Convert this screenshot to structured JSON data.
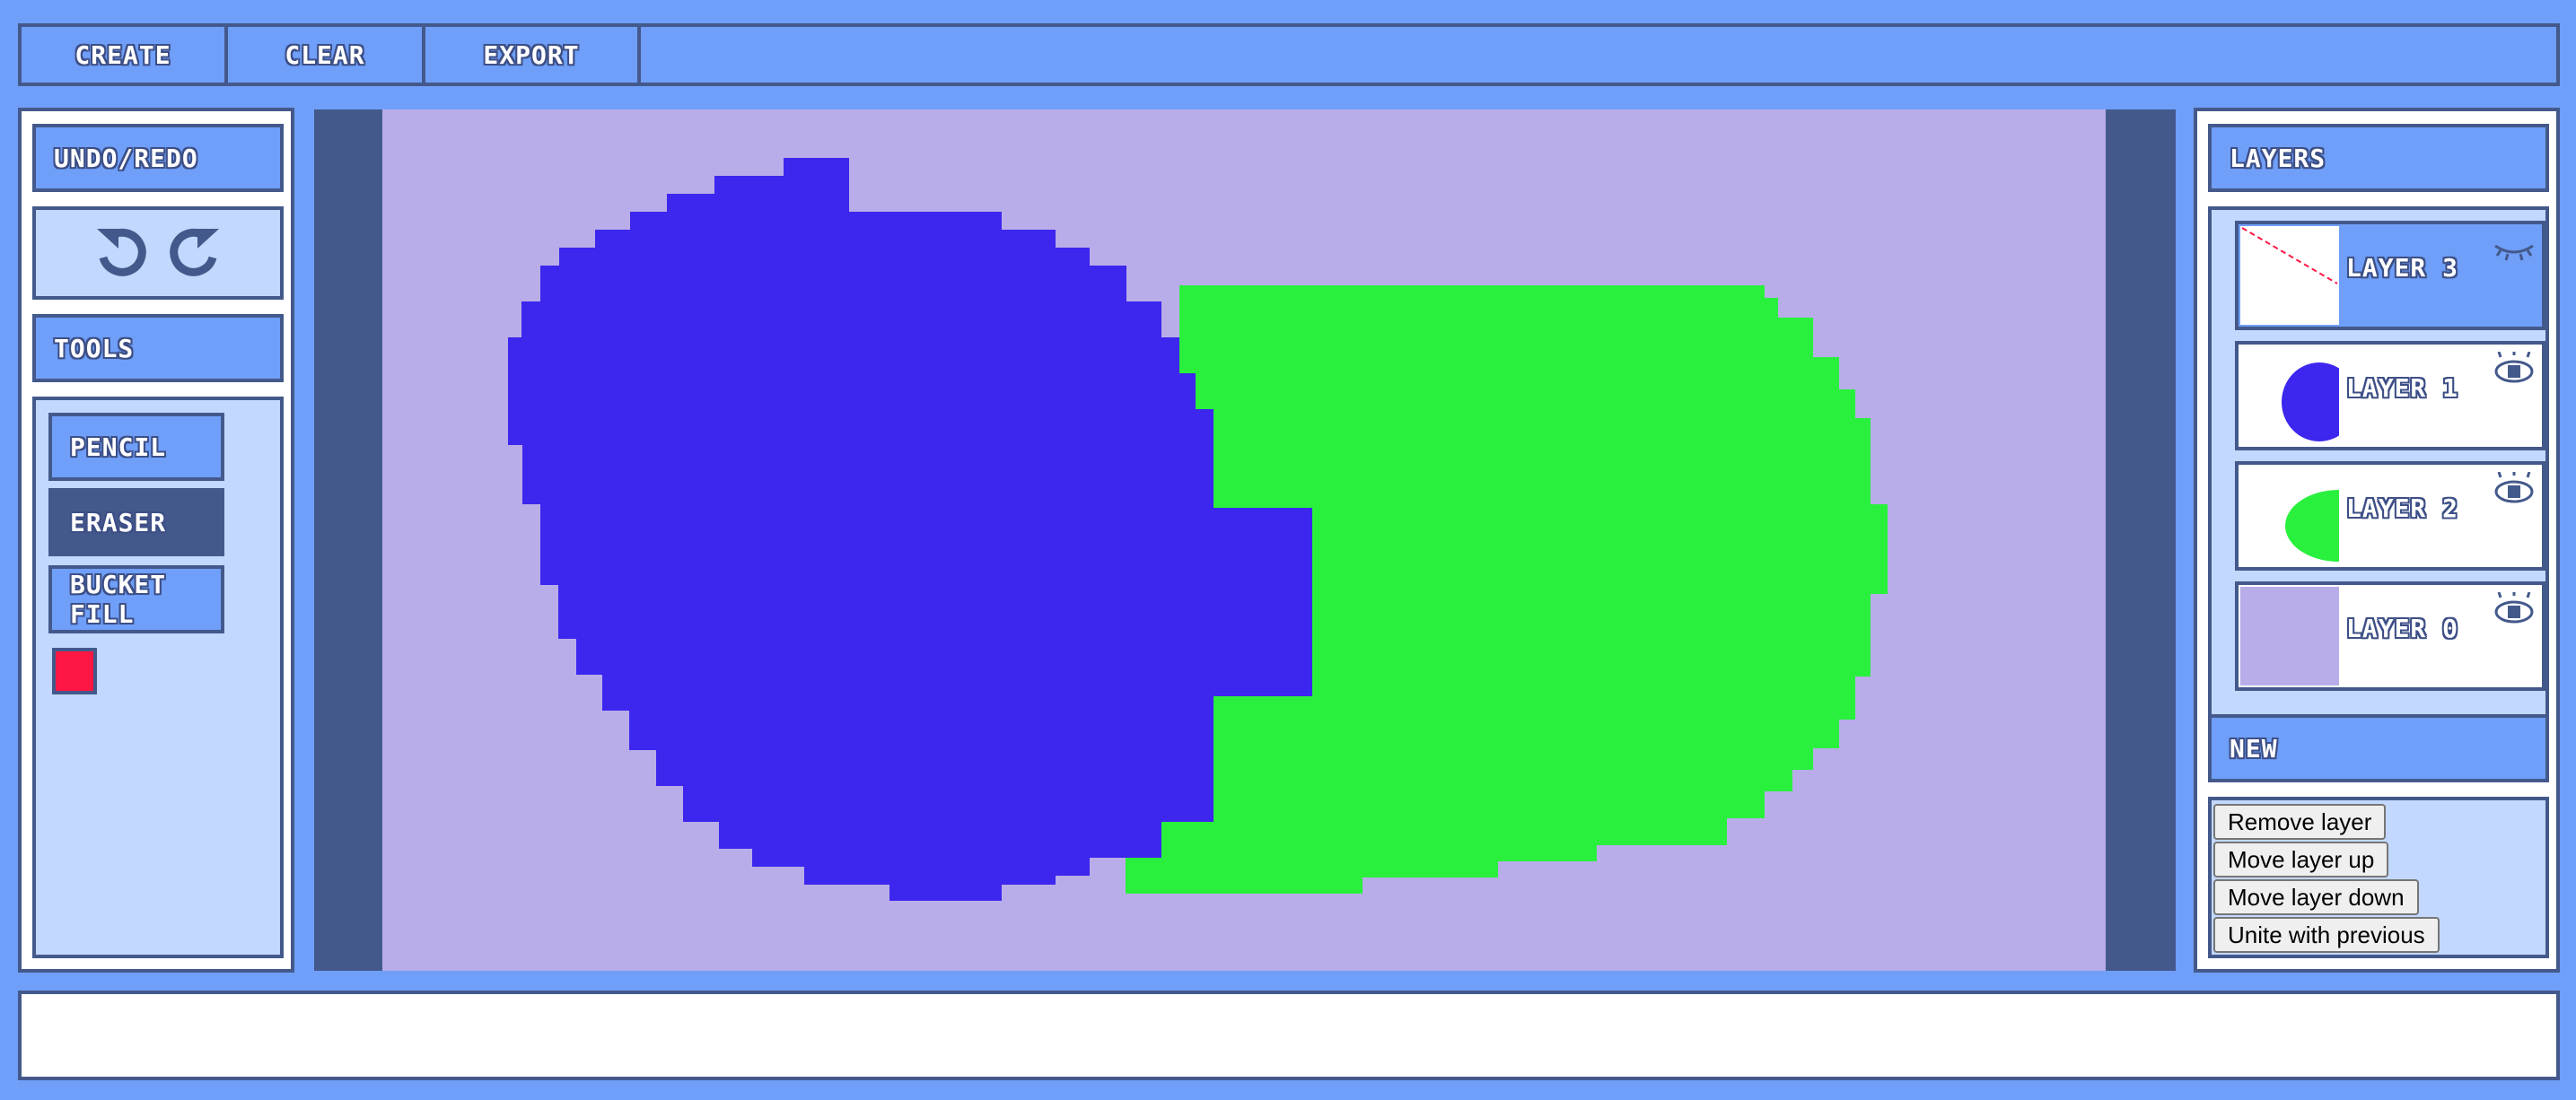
{
  "menubar": {
    "create": "CREATE",
    "clear": "CLEAR",
    "export": "EXPORT"
  },
  "left_panel": {
    "undo_redo_header": "UNDO/REDO",
    "tools_header": "TOOLS",
    "tools": [
      {
        "label": "PENCIL",
        "active": false
      },
      {
        "label": "ERASER",
        "active": true
      },
      {
        "label": "BUCKET FILL",
        "active": false
      }
    ],
    "current_color": "#ff1744"
  },
  "canvas": {
    "background_color": "#b8ade8",
    "shapes": [
      {
        "name": "blue ellipse",
        "color": "#3d26ee"
      },
      {
        "name": "green ellipse",
        "color": "#29f03d"
      }
    ]
  },
  "right_panel": {
    "layers_header": "LAYERS",
    "layers": [
      {
        "label": "LAYER 3",
        "selected": true,
        "visible": false
      },
      {
        "label": "LAYER 1",
        "selected": false,
        "visible": true
      },
      {
        "label": "LAYER 2",
        "selected": false,
        "visible": true
      },
      {
        "label": "LAYER 0",
        "selected": false,
        "visible": true
      }
    ],
    "new_button": "NEW",
    "actions": [
      "Remove layer",
      "Move layer up",
      "Move layer down",
      "Unite with previous"
    ]
  },
  "colors": {
    "ui_blue": "#6f9ff8",
    "ui_dark": "#44598b",
    "ui_light": "#c2d8fe"
  }
}
